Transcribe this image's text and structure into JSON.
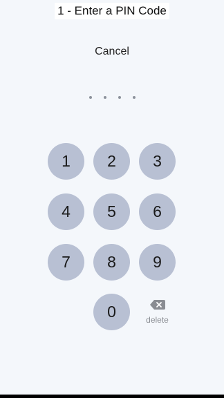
{
  "header": {
    "title": "1 - Enter a PIN Code"
  },
  "actions": {
    "cancel_label": "Cancel"
  },
  "pin": {
    "length": 4,
    "entered": 0
  },
  "keypad": {
    "keys": [
      "1",
      "2",
      "3",
      "4",
      "5",
      "6",
      "7",
      "8",
      "9",
      "0"
    ],
    "delete_label": "delete",
    "delete_icon": "backspace-icon"
  },
  "colors": {
    "background": "#f4f7fb",
    "key_fill": "#b8c0d3",
    "dot": "#8c929c"
  }
}
